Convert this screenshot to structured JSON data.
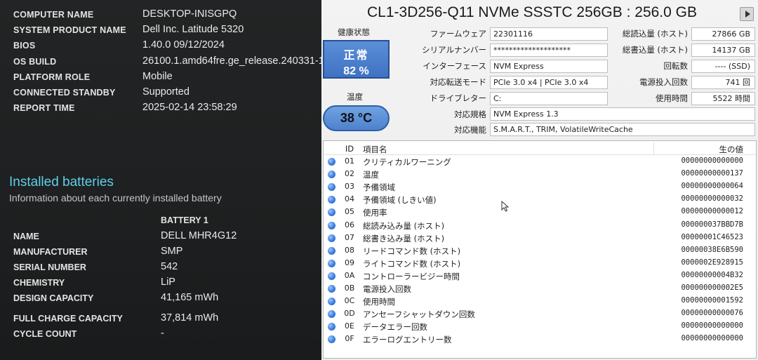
{
  "left": {
    "system_rows": [
      {
        "key": "COMPUTER NAME",
        "value": "DESKTOP-INISGPQ"
      },
      {
        "key": "SYSTEM PRODUCT NAME",
        "value": "Dell Inc. Latitude 5320"
      },
      {
        "key": "BIOS",
        "value": "1.40.0 09/12/2024"
      },
      {
        "key": "OS BUILD",
        "value": "26100.1.amd64fre.ge_release.240331-1435"
      },
      {
        "key": "PLATFORM ROLE",
        "value": "Mobile"
      },
      {
        "key": "CONNECTED STANDBY",
        "value": "Supported"
      },
      {
        "key": "REPORT TIME",
        "value": "2025-02-14  23:58:29"
      }
    ],
    "installed_title": "Installed batteries",
    "installed_subtitle": "Information about each currently installed battery",
    "battery_column": "BATTERY 1",
    "battery_rows": [
      {
        "key": "NAME",
        "value": "DELL MHR4G12"
      },
      {
        "key": "MANUFACTURER",
        "value": "SMP"
      },
      {
        "key": "SERIAL NUMBER",
        "value": "542"
      },
      {
        "key": "CHEMISTRY",
        "value": "LiP"
      },
      {
        "key": "DESIGN CAPACITY",
        "value": "41,165 mWh"
      },
      {
        "key": "FULL CHARGE CAPACITY",
        "value": "37,814 mWh"
      },
      {
        "key": "CYCLE COUNT",
        "value": "-"
      }
    ]
  },
  "right": {
    "disk_title": "CL1-3D256-Q11 NVMe SSSTC 256GB : 256.0 GB",
    "health_label": "健康状態",
    "health_status": "正常",
    "health_percent": "82 %",
    "temp_label": "温度",
    "temp_value": "38 °C",
    "info": {
      "firmware_label": "ファームウェア",
      "firmware": "22301116",
      "serial_label": "シリアルナンバー",
      "serial": "********************",
      "interface_label": "インターフェース",
      "interface": "NVM Express",
      "transfer_label": "対応転送モード",
      "transfer": "PCIe 3.0 x4 | PCIe 3.0 x4",
      "drive_letter_label": "ドライブレター",
      "drive_letter": "C:",
      "standard_label": "対応規格",
      "standard": "NVM Express 1.3",
      "features_label": "対応機能",
      "features": "S.M.A.R.T., TRIM, VolatileWriteCache",
      "host_reads_label": "総読込量 (ホスト)",
      "host_reads": "27866 GB",
      "host_writes_label": "総書込量 (ホスト)",
      "host_writes": "14137 GB",
      "rotation_label": "回転数",
      "rotation": "---- (SSD)",
      "power_count_label": "電源投入回数",
      "power_count": "741 回",
      "power_hours_label": "使用時間",
      "power_hours": "5522 時間"
    },
    "smart_header": {
      "id": "ID",
      "name": "項目名",
      "raw": "生の値"
    },
    "smart_rows": [
      {
        "id": "01",
        "name": "クリティカルワーニング",
        "raw": "00000000000000"
      },
      {
        "id": "02",
        "name": "温度",
        "raw": "00000000000137"
      },
      {
        "id": "03",
        "name": "予備領域",
        "raw": "00000000000064"
      },
      {
        "id": "04",
        "name": "予備領域 (しきい値)",
        "raw": "00000000000032"
      },
      {
        "id": "05",
        "name": "使用率",
        "raw": "00000000000012"
      },
      {
        "id": "06",
        "name": "総読み込み量 (ホスト)",
        "raw": "000000037BBD7B"
      },
      {
        "id": "07",
        "name": "総書き込み量 (ホスト)",
        "raw": "00000001C46523"
      },
      {
        "id": "08",
        "name": "リードコマンド数 (ホスト)",
        "raw": "00000038E6B590"
      },
      {
        "id": "09",
        "name": "ライトコマンド数 (ホスト)",
        "raw": "0000002E928915"
      },
      {
        "id": "0A",
        "name": "コントローラービジー時間",
        "raw": "00000000004B32"
      },
      {
        "id": "0B",
        "name": "電源投入回数",
        "raw": "000000000002E5"
      },
      {
        "id": "0C",
        "name": "使用時間",
        "raw": "00000000001592"
      },
      {
        "id": "0D",
        "name": "アンセーフシャットダウン回数",
        "raw": "00000000000076"
      },
      {
        "id": "0E",
        "name": "データエラー回数",
        "raw": "00000000000000"
      },
      {
        "id": "0F",
        "name": "エラーログエントリー数",
        "raw": "00000000000000"
      }
    ]
  }
}
